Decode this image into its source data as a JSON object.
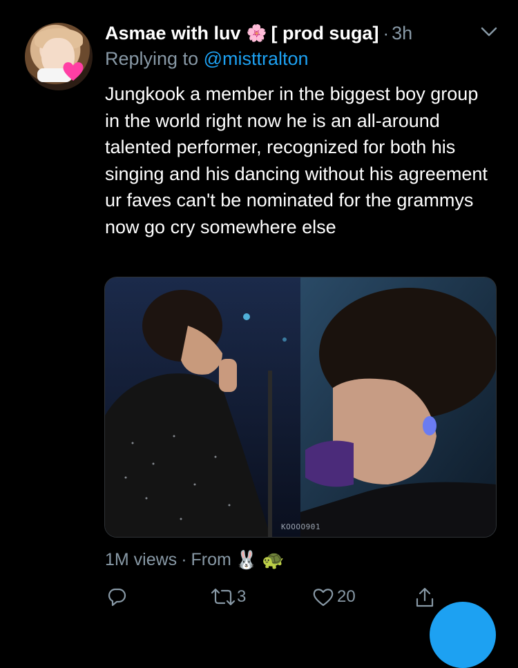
{
  "tweet": {
    "author_name": "Asmae with luv",
    "name_emoji": "🌸",
    "name_suffix": "[ prod suga]",
    "separator": "·",
    "time": "3h",
    "reply_prefix": "Replying to",
    "reply_handle": "@misttralton",
    "text": "Jungkook a member in the biggest boy group in the world right now he is an all-around talented performer, recognized for both his singing and his dancing without his agreement ur faves can't be nominated for the grammys now go cry somewhere else",
    "media_watermark": "KOOOO901"
  },
  "meta": {
    "views": "1M views",
    "separator": "·",
    "from_label": "From",
    "from_emojis": [
      "🐰",
      "🐢"
    ]
  },
  "actions": {
    "reply_count": "",
    "retweet_count": "3",
    "like_count": "20"
  },
  "colors": {
    "background": "#000000",
    "secondary_text": "#8899a6",
    "link": "#1da1f2"
  },
  "icons": [
    "chevron-down-icon",
    "reply-icon",
    "retweet-icon",
    "like-icon",
    "share-icon"
  ]
}
